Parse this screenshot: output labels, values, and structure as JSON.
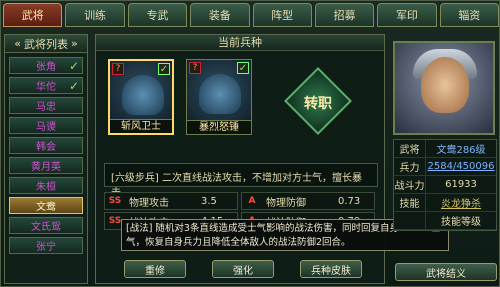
{
  "tabs": [
    "武将",
    "训练",
    "专武",
    "装备",
    "阵型",
    "招募",
    "军印",
    "辎资"
  ],
  "left_panel": {
    "header": "武将列表",
    "items": [
      {
        "label": "张角",
        "checked": true
      },
      {
        "label": "华佗",
        "checked": true
      },
      {
        "label": "马忠",
        "checked": false
      },
      {
        "label": "马谡",
        "checked": false
      },
      {
        "label": "韩会",
        "checked": false
      },
      {
        "label": "黄月英",
        "checked": false
      },
      {
        "label": "朱桓",
        "checked": false
      },
      {
        "label": "文鸯",
        "checked": false,
        "selected": true
      },
      {
        "label": "文氏鸳",
        "checked": false
      },
      {
        "label": "张宁",
        "checked": false
      }
    ]
  },
  "center": {
    "title": "当前兵种",
    "units": [
      {
        "label": "斩风卫士",
        "q": "?",
        "check": "✓",
        "selected": true
      },
      {
        "label": "暴烈怒锤",
        "q": "?",
        "check": "✓",
        "selected": false
      }
    ],
    "transfer_label": "转职",
    "description": "[六级步兵] 二次直线战法攻击，不增加对方士气，擅长暴击。",
    "stats": [
      {
        "grade": "SS",
        "name": "物理攻击",
        "value": "3.5"
      },
      {
        "grade": "A",
        "name": "物理防御",
        "value": "0.73"
      },
      {
        "grade": "SS",
        "name": "战法攻击",
        "value": "4.15"
      },
      {
        "grade": "A",
        "name": "战法防御",
        "value": "0.79"
      }
    ],
    "tooltip": "[战法] 随机对3条直线造成受士气影响的战法伤害，同时回复自身50~50士气，恢复自身兵力且降低全体敌人的战法防御2回合。",
    "buttons": {
      "reset": "重修",
      "strengthen": "强化",
      "skin": "兵种皮肤"
    }
  },
  "right": {
    "rows": [
      {
        "key": "武将",
        "value": "文鸯286级"
      },
      {
        "key": "兵力",
        "value": "2584/450096"
      },
      {
        "key": "战斗力",
        "value": "61933"
      },
      {
        "key": "技能",
        "value": "炎龙狰杀"
      },
      {
        "key": "",
        "value": "技能等级"
      }
    ],
    "bottom_button": "武将结义"
  }
}
